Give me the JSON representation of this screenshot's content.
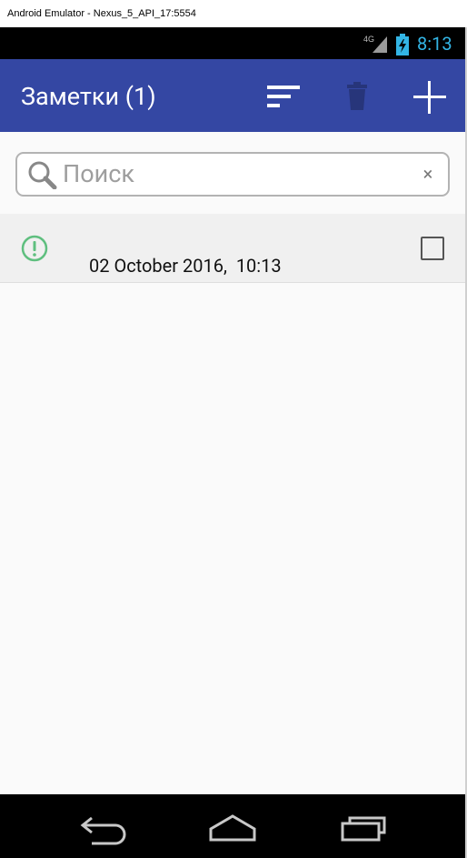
{
  "window": {
    "title": "Android Emulator - Nexus_5_API_17:5554"
  },
  "status_bar": {
    "network": "4G",
    "time": "8:13",
    "time_color": "#33b5e5"
  },
  "app_bar": {
    "title": "Заметки (1)",
    "color": "#3447a3",
    "actions": [
      {
        "name": "sort",
        "icon": "sort-icon"
      },
      {
        "name": "delete",
        "icon": "trash-icon",
        "enabled": false
      },
      {
        "name": "add",
        "icon": "plus-icon"
      }
    ]
  },
  "search": {
    "placeholder": "Поиск",
    "value": "",
    "clear_label": "×"
  },
  "notes": [
    {
      "priority_icon": "alert-circle-icon",
      "priority_color": "#5fbf7f",
      "date": "02 October 2016,  10:13",
      "checked": false
    }
  ],
  "nav_bar": {
    "buttons": [
      "back-icon",
      "home-icon",
      "recent-apps-icon"
    ]
  }
}
